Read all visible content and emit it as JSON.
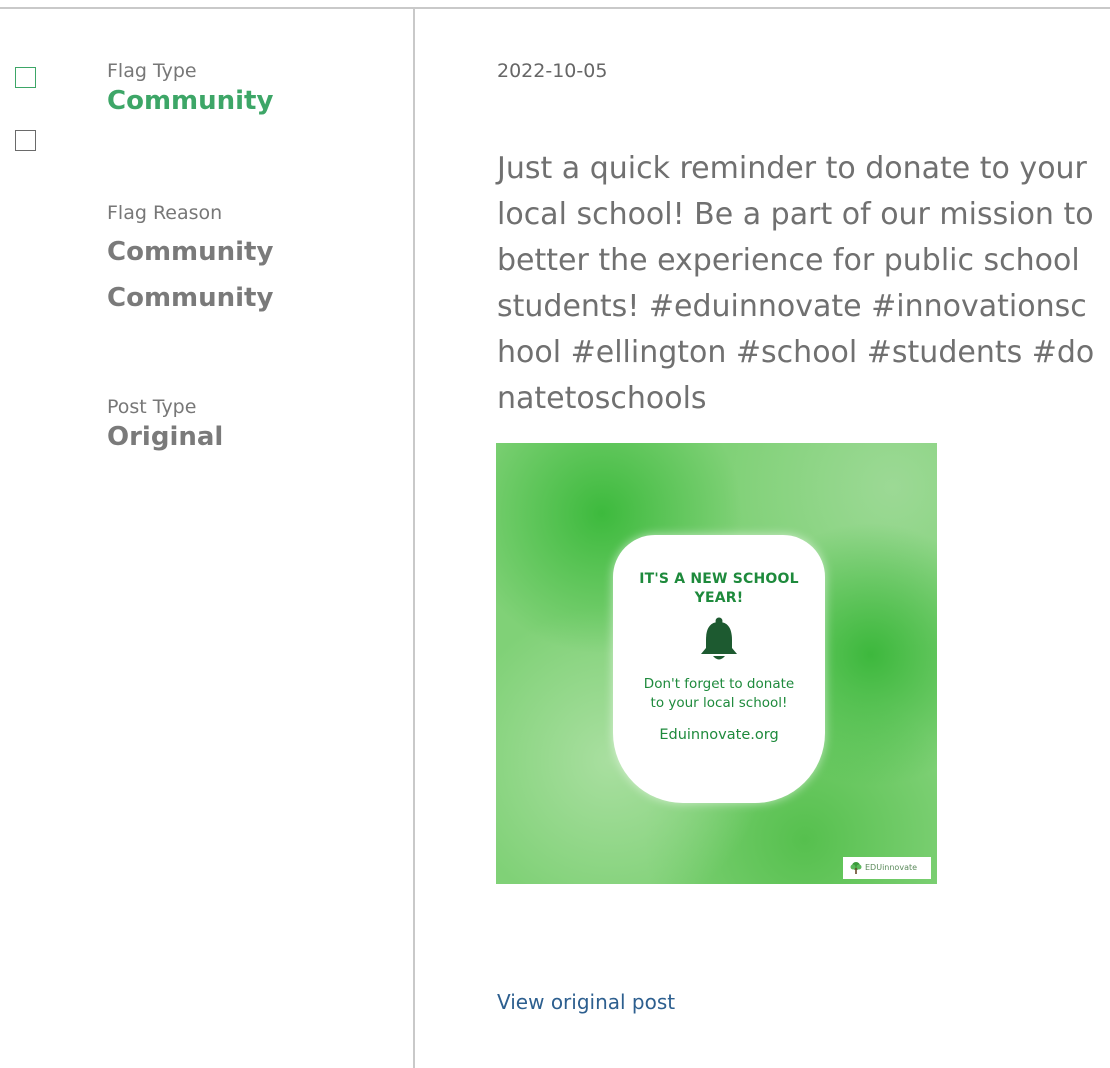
{
  "sidebar": {
    "flag_type_label": "Flag Type",
    "flag_type_value": "Community",
    "flag_reason_label": "Flag Reason",
    "flag_reason_values": [
      "Community",
      "Community"
    ],
    "post_type_label": "Post Type",
    "post_type_value": "Original"
  },
  "post": {
    "date": "2022-10-05",
    "text": "Just a quick reminder to donate to your local school! Be a part of our mission to better the experience for public school students! #eduinnovate #innovationschool #ellington #school #students #donatetoschools",
    "image": {
      "headline": "IT'S A NEW SCHOOL YEAR!",
      "body": "Don't forget to donate to your local school!",
      "url": "Eduinnovate.org",
      "logo_text": "EDUinnovate",
      "icon": "bell-icon"
    },
    "link_label": "View original post"
  },
  "colors": {
    "accent_green": "#3da667",
    "link_blue": "#2d5f8f",
    "divider": "#c9c9c9",
    "image_green": "#80d177",
    "card_text_green": "#1e8a3c"
  }
}
